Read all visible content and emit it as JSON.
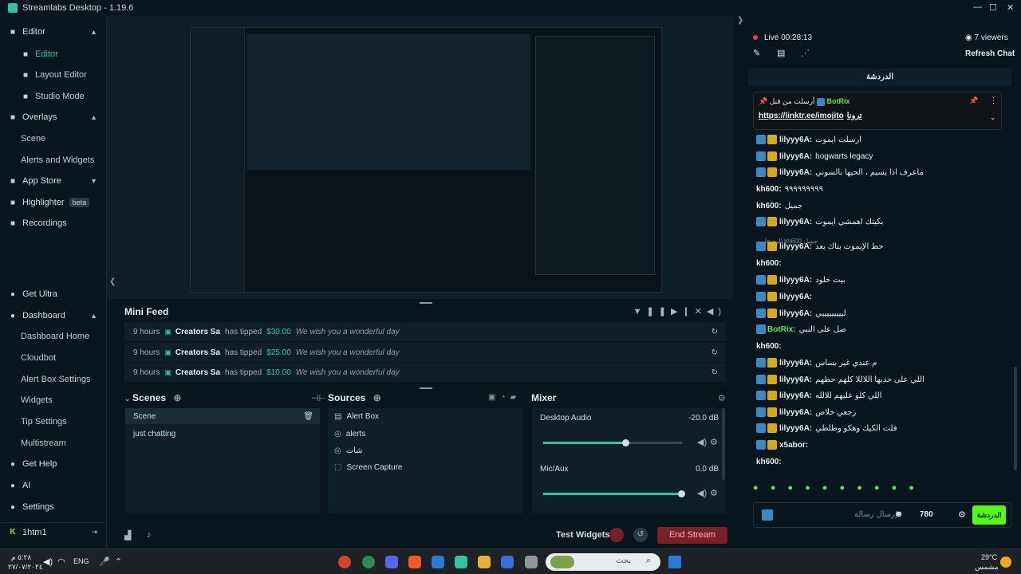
{
  "window": {
    "title": "Streamlabs Desktop - 1.19.6"
  },
  "sidebar": {
    "items": [
      {
        "label": "Editor",
        "icon": "editor-icon",
        "section": true,
        "chev": "▲"
      },
      {
        "label": "Editor",
        "icon": "editor-icon",
        "sub": true,
        "active": true
      },
      {
        "label": "Layout Editor",
        "icon": "layout-icon",
        "sub": true
      },
      {
        "label": "Studio Mode",
        "icon": "studio-icon",
        "sub": true
      },
      {
        "label": "Overlays",
        "icon": "overlays-icon",
        "section": true,
        "chev": "▲"
      },
      {
        "label": "Scene",
        "sub": true
      },
      {
        "label": "Alerts and Widgets",
        "sub": true
      },
      {
        "label": "App Store",
        "icon": "app-store-icon",
        "section": true,
        "chev": "▼"
      },
      {
        "label": "Highlighter",
        "icon": "highlighter-icon",
        "badge": "beta"
      },
      {
        "label": "Recordings",
        "icon": "recordings-icon"
      }
    ],
    "bottom": [
      {
        "label": "Get Ultra",
        "icon": "ultra-icon"
      },
      {
        "label": "Dashboard",
        "icon": "dashboard-icon",
        "chev": "▲"
      },
      {
        "label": "Dashboard Home",
        "sub": true
      },
      {
        "label": "Cloudbot",
        "sub": true
      },
      {
        "label": "Alert Box Settings",
        "sub": true
      },
      {
        "label": "Widgets",
        "sub": true
      },
      {
        "label": "Tip Settings",
        "sub": true
      },
      {
        "label": "Multistream",
        "sub": true
      },
      {
        "label": "Get Help",
        "icon": "help-icon"
      },
      {
        "label": "AI",
        "icon": "ai-icon"
      },
      {
        "label": "Settings",
        "icon": "gear-icon"
      },
      {
        "label": "1htm1",
        "icon": "kick-icon"
      }
    ]
  },
  "minifeed": {
    "title": "Mini Feed",
    "events": [
      {
        "time": "9 hours",
        "name": "Creators Sa",
        "verb": "has tipped",
        "amount": "$30.00",
        "message": "We wish you a wonderful day"
      },
      {
        "time": "9 hours",
        "name": "Creators Sa",
        "verb": "has tipped",
        "amount": "$25.00",
        "message": "We wish you a wonderful day"
      },
      {
        "time": "9 hours",
        "name": "Creators Sa",
        "verb": "has tipped",
        "amount": "$10.00",
        "message": "We wish you a wonderful day"
      }
    ]
  },
  "scenes": {
    "title": "Scenes",
    "items": [
      "Scene",
      "just chatting"
    ]
  },
  "sources": {
    "title": "Sources",
    "items": [
      "Alert Box",
      "alerts",
      "شات",
      "Screen Capture"
    ]
  },
  "mixer": {
    "title": "Mixer",
    "channels": [
      {
        "name": "Desktop Audio",
        "db": "-20.0 dB",
        "level": 0.6
      },
      {
        "name": "Mic/Aux",
        "db": "0.0 dB",
        "level": 1.0
      }
    ]
  },
  "footer": {
    "test_widgets": "Test Widgets",
    "end_stream": "End Stream"
  },
  "chat": {
    "live": "Live 00:28:13",
    "viewers": "7 viewers",
    "refresh": "Refresh Chat",
    "tab": "الدردشة",
    "pinned_user": "BotRix",
    "pinned_text": "أرسلت من قبل",
    "pinned_link": "https://linktr.ee/imojito",
    "pinned_extra": "ترونا",
    "messages": [
      {
        "user": "lilyyy6A:",
        "text": "ارسلت ايموت"
      },
      {
        "user": "lilyyy6A:",
        "text": "hogwarts legacy"
      },
      {
        "user": "lilyyy6A:",
        "text": "ماعرف اذا يسيم ، الحيها بالسوني"
      },
      {
        "user": "kh600:",
        "text": "٩٩٩٩٩٩٩٩٩",
        "plain": true
      },
      {
        "user": "kh600:",
        "text": "جميل",
        "plain": true
      },
      {
        "user": "lilyyy6A:",
        "text": "بكيتك اهمشي ايموت"
      },
      {
        "user": "lilyyy6A:",
        "text": "حط الإيموت بتاك بعد",
        "reply": "الرد على kh600 جميل"
      },
      {
        "user": "kh600:",
        "text": "",
        "plain": true
      },
      {
        "user": "lilyyy6A:",
        "text": "بيت خلود"
      },
      {
        "user": "lilyyy6A:",
        "text": ""
      },
      {
        "user": "lilyyy6A:",
        "text": "ليييييييييي"
      },
      {
        "user": "BotRix:",
        "text": "صل على النبي",
        "bot": true
      },
      {
        "user": "kh600:",
        "text": "",
        "plain": true
      },
      {
        "user": "lilyyy6A:",
        "text": "م عندي غير بساس"
      },
      {
        "user": "lilyyy6A:",
        "text": "اللي على حدبها اللاللا كلهم حطهم"
      },
      {
        "user": "lilyyy6A:",
        "text": "اللي كلو عليهم للالله"
      },
      {
        "user": "lilyyy6A:",
        "text": "رجعي خلاص"
      },
      {
        "user": "lilyyy6A:",
        "text": "فلت الكيك وهكو وطلطي"
      },
      {
        "user": "x5abor:",
        "text": ""
      },
      {
        "user": "kh600:",
        "text": "",
        "plain": true
      }
    ],
    "input_placeholder": "إرسال رسالة",
    "points": "780",
    "send": "الدردشة"
  },
  "taskbar": {
    "time": "٥:٢٨ م",
    "date": "٢٧/٠٧/٢٠٢٤",
    "lang": "ENG",
    "search_placeholder": "بحث",
    "weather_temp": "29°C",
    "weather_desc": "مشمس"
  },
  "colors": {
    "accent": "#31c3a2",
    "end_stream": "#7a1f28",
    "bot": "#5ee35c"
  }
}
